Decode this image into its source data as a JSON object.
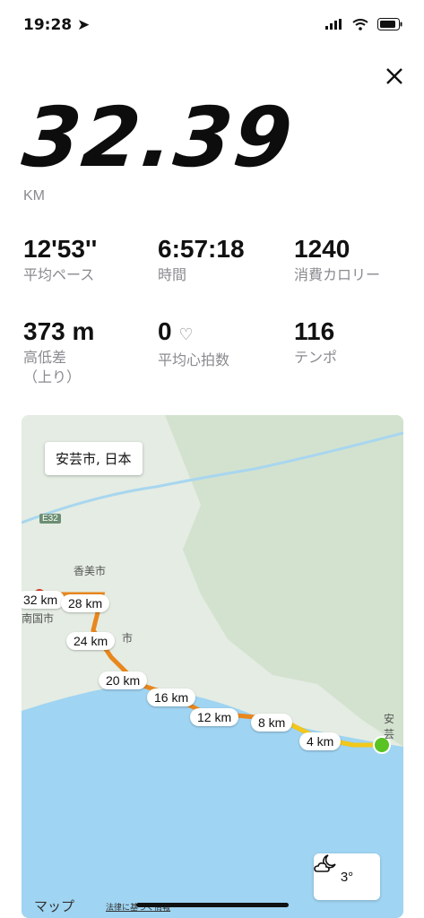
{
  "status": {
    "time": "19:28"
  },
  "summary": {
    "distance": "32.39",
    "unit": "KM"
  },
  "stats": [
    {
      "value": "12'53''",
      "label": "平均ペース"
    },
    {
      "value": "6:57:18",
      "label": "時間"
    },
    {
      "value": "1240",
      "label": "消費カロリー"
    },
    {
      "value": "373 m",
      "label": "高低差\n（上り）"
    },
    {
      "value": "0",
      "label": "平均心拍数"
    },
    {
      "value": "116",
      "label": "テンポ"
    }
  ],
  "map": {
    "place": "安芸市, 日本",
    "road_shield": "E32",
    "cities": [
      "香美市",
      "南国市",
      "市",
      "安芸"
    ],
    "km_markers": [
      "32 km",
      "28 km",
      "24 km",
      "20 km",
      "16 km",
      "12 km",
      "8 km",
      "4 km"
    ],
    "weather": {
      "temp": "3°"
    },
    "logo": "マップ",
    "legal": "法律に基づく情報",
    "colors": {
      "sea": "#9fd4f2",
      "land": "#e4ece3",
      "route_yellow": "#f2c81b",
      "route_orange": "#e8871e",
      "route_red": "#d23a2a",
      "start": "#58c322"
    }
  }
}
